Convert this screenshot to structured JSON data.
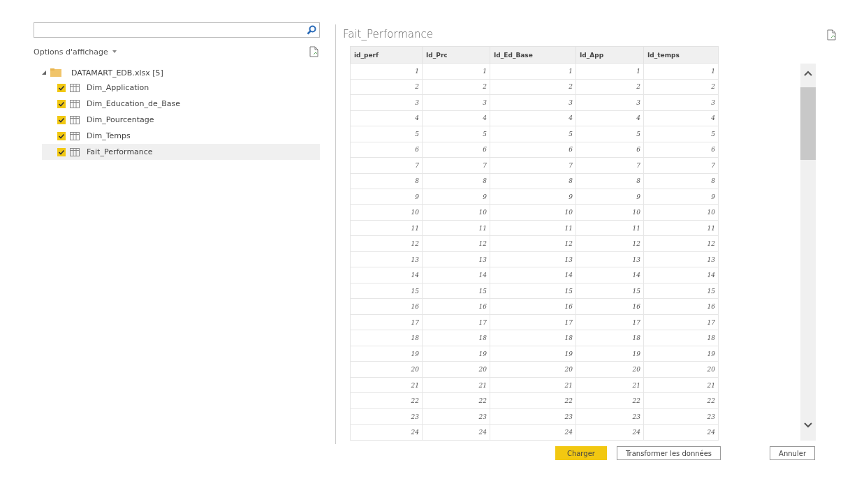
{
  "navigator": {
    "options_label": "Options d'affichage",
    "tree": {
      "label": "DATAMART_EDB.xlsx [5]",
      "expanded": true,
      "children": [
        {
          "label": "Dim_Application",
          "checked": true,
          "selected": false
        },
        {
          "label": "Dim_Education_de_Base",
          "checked": true,
          "selected": false
        },
        {
          "label": "Dim_Pourcentage",
          "checked": true,
          "selected": false
        },
        {
          "label": "Dim_Temps",
          "checked": true,
          "selected": false
        },
        {
          "label": "Fait_Performance",
          "checked": true,
          "selected": true
        }
      ]
    }
  },
  "preview": {
    "title": "Fait_Performance",
    "table": {
      "columns": [
        "id_perf",
        "Id_Prc",
        "Id_Ed_Base",
        "Id_App",
        "Id_temps"
      ],
      "rows": [
        [
          "1",
          "1",
          "1",
          "1",
          "1"
        ],
        [
          "2",
          "2",
          "2",
          "2",
          "2"
        ],
        [
          "3",
          "3",
          "3",
          "3",
          "3"
        ],
        [
          "4",
          "4",
          "4",
          "4",
          "4"
        ],
        [
          "5",
          "5",
          "5",
          "5",
          "5"
        ],
        [
          "6",
          "6",
          "6",
          "6",
          "6"
        ],
        [
          "7",
          "7",
          "7",
          "7",
          "7"
        ],
        [
          "8",
          "8",
          "8",
          "8",
          "8"
        ],
        [
          "9",
          "9",
          "9",
          "9",
          "9"
        ],
        [
          "10",
          "10",
          "10",
          "10",
          "10"
        ],
        [
          "11",
          "11",
          "11",
          "11",
          "11"
        ],
        [
          "12",
          "12",
          "12",
          "12",
          "12"
        ],
        [
          "13",
          "13",
          "13",
          "13",
          "13"
        ],
        [
          "14",
          "14",
          "14",
          "14",
          "14"
        ],
        [
          "15",
          "15",
          "15",
          "15",
          "15"
        ],
        [
          "16",
          "16",
          "16",
          "16",
          "16"
        ],
        [
          "17",
          "17",
          "17",
          "17",
          "17"
        ],
        [
          "18",
          "18",
          "18",
          "18",
          "18"
        ],
        [
          "19",
          "19",
          "19",
          "19",
          "19"
        ],
        [
          "20",
          "20",
          "20",
          "20",
          "20"
        ],
        [
          "21",
          "21",
          "21",
          "21",
          "21"
        ],
        [
          "22",
          "22",
          "22",
          "22",
          "22"
        ],
        [
          "23",
          "23",
          "23",
          "23",
          "23"
        ],
        [
          "24",
          "24",
          "24",
          "24",
          "24"
        ]
      ]
    }
  },
  "buttons": [
    {
      "label": "Charger",
      "kind": "primary"
    },
    {
      "label": "Transformer les données",
      "kind": "secondary"
    },
    {
      "label": "Annuler",
      "kind": "secondary"
    }
  ]
}
